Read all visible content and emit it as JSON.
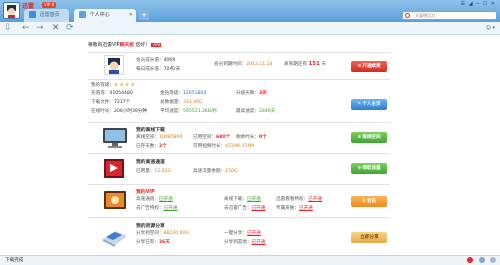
{
  "window": {
    "brand": "迅雷",
    "vip_badge": "VIP 8",
    "tabs": [
      {
        "label": "迅雷首页"
      },
      {
        "label": "个人中心"
      }
    ],
    "new_tab": "+",
    "controls": "☰ ◢ ─ ☐ ✕",
    "search_placeholder": "天涯明月刀",
    "status_text": "下载完成"
  },
  "nav": {
    "back": "←",
    "forward": "→",
    "close": "✕",
    "refresh": "⟳",
    "download_icon": "⇩",
    "user_menu": "☺ ▾"
  },
  "welcome": {
    "prefix": "尊敬的迅雷VIP",
    "name": "刷天姐",
    "suffix": " 您好！",
    "badge": "VIP8"
  },
  "profile": {
    "member_label": "会员成长值：",
    "member_value": "4069",
    "daily_label": "每日成长值：",
    "daily_value": "70点/天",
    "expire_label": "会员到期时间：",
    "expire_value": "2012.11.24",
    "days_label": "离到期还有",
    "days_value": "151",
    "days_unit": "天",
    "button": "开通续费",
    "button_prefix": "⊕"
  },
  "account": {
    "level_label": "我的等级：",
    "level_value": "♛ ♛ ♛ ♛",
    "points_label": "充值等：",
    "points_value": "41054480",
    "gold_label": "金钻等级：",
    "gold_value": "12651804",
    "thunder_label": "升级天数：",
    "thunder_value": "3天",
    "dl_label": "下载文件：",
    "dl_value": "7217个",
    "total_label": "总数据量：",
    "total_value": "333.46G",
    "ratio_label": "超过比例：",
    "ratio_value": "",
    "online_label": "在线时长：",
    "online_value": "206小时39分钟",
    "avg_label": "平均速度：",
    "avg_value": "595523.2KB/秒",
    "peak_label": "最高速度：",
    "peak_value": "2849天",
    "button": "个人主页",
    "button_prefix": "✎"
  },
  "offline": {
    "title": "我的离线下载",
    "space_label": "离线空间：",
    "space_value": "10485800",
    "used_label": "已用空间：",
    "used_value": "680个",
    "files_label": "剩余时长：",
    "files_value": "0个",
    "remain_label": "已存天数：",
    "remain_value": "2个",
    "vod_label": "可用视频时长：",
    "vod_value": "47299.374M",
    "button": "离线空间",
    "button_prefix": "⊕"
  },
  "highspeed": {
    "title": "我的高速通道",
    "flow_label": "已用量：",
    "flow_value": "12.61G",
    "remain_label": "高速流量余额：",
    "remain_value": "150G",
    "button": "领取流量",
    "button_prefix": "⊕"
  },
  "vip": {
    "title": "我的VIP",
    "r1_label": "高速通道：",
    "r1_value": "已开通",
    "r2_label": "离线下载：",
    "r2_value": "已开通",
    "r3_label": "去广告特权：",
    "r3_value": "已开通",
    "r4_label": "迅雷看看特权：",
    "r4_value": "已开通",
    "r5_label": "去迅雷广告：",
    "r5_value": "已开通",
    "r6_label": "专属皮肤：",
    "r6_value": "已开通",
    "button": "会员",
    "button_prefix": "♛"
  },
  "share": {
    "title": "我的资源分享",
    "s1_label": "分享到空间：",
    "s1_value": "88230.80G",
    "s2_label": "一键分享：",
    "s2_value": "已开通",
    "s3_label": "分享已有：",
    "s3_value": "36天",
    "s4_label": "分享到其他：",
    "s4_value": "已开通",
    "button": "立即分享",
    "button_prefix": ""
  }
}
